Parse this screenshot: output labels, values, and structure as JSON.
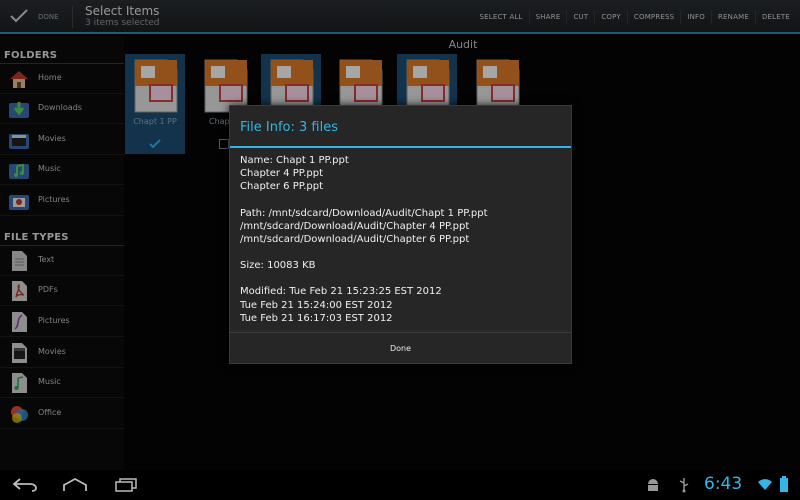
{
  "actionbar": {
    "done_label": "DONE",
    "title": "Select Items",
    "subtitle": "3 items selected",
    "actions": [
      "SELECT ALL",
      "SHARE",
      "CUT",
      "COPY",
      "COMPRESS",
      "INFO",
      "RENAME",
      "DELETE"
    ]
  },
  "sidebar": {
    "folders_header": "FOLDERS",
    "folders": [
      {
        "label": "Home",
        "icon": "home-icon"
      },
      {
        "label": "Downloads",
        "icon": "downloads-folder-icon"
      },
      {
        "label": "Movies",
        "icon": "movies-folder-icon"
      },
      {
        "label": "Music",
        "icon": "music-folder-icon"
      },
      {
        "label": "Pictures",
        "icon": "pictures-folder-icon"
      }
    ],
    "filetypes_header": "FILE TYPES",
    "filetypes": [
      {
        "label": "Text",
        "icon": "text-file-icon"
      },
      {
        "label": "PDFs",
        "icon": "pdf-icon"
      },
      {
        "label": "Pictures",
        "icon": "pictures-icon"
      },
      {
        "label": "Movies",
        "icon": "movies-icon"
      },
      {
        "label": "Music",
        "icon": "music-note-icon"
      },
      {
        "label": "Office",
        "icon": "office-icon"
      }
    ]
  },
  "main": {
    "folder_title": "Audit",
    "files": [
      {
        "name": "Chapt 1 PP",
        "selected": true
      },
      {
        "name": "Chapter",
        "selected": false
      },
      {
        "name": "",
        "selected": true
      },
      {
        "name": "",
        "selected": false
      },
      {
        "name": "",
        "selected": true
      },
      {
        "name": "",
        "selected": false
      }
    ]
  },
  "dialog": {
    "title": "File Info: 3 files",
    "name_lines": [
      "Name: Chapt 1 PP.ppt",
      "Chapter 4 PP.ppt",
      "Chapter 6 PP.ppt"
    ],
    "path_lines": [
      "Path: /mnt/sdcard/Download/Audit/Chapt 1 PP.ppt",
      "/mnt/sdcard/Download/Audit/Chapter 4 PP.ppt",
      "/mnt/sdcard/Download/Audit/Chapter 6 PP.ppt"
    ],
    "size_line": "Size: 10083 KB",
    "modified_lines": [
      "Modified: Tue Feb 21 15:23:25 EST 2012",
      "Tue Feb 21 15:24:00 EST 2012",
      "Tue Feb 21 16:17:03 EST 2012"
    ],
    "done_label": "Done"
  },
  "statusbar": {
    "time": "6:43"
  },
  "colors": {
    "accent": "#33b5e5",
    "selected_tile": "#1d4f73",
    "dialog_bg": "#262626"
  }
}
